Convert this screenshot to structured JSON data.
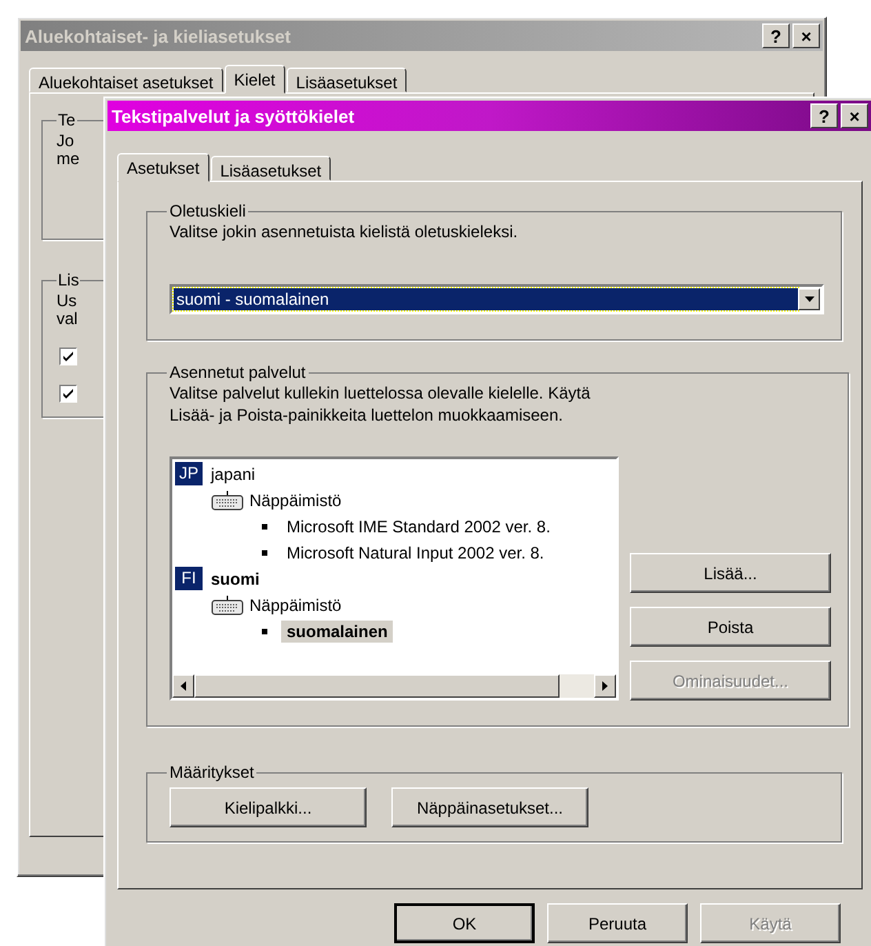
{
  "back_window": {
    "title": "Aluekohtaiset- ja kieliasetukset",
    "active": false,
    "title_buttons": [
      "?",
      "×"
    ],
    "tabs": [
      {
        "label": "Aluekohtaiset asetukset",
        "selected": false
      },
      {
        "label": "Kielet",
        "selected": true
      },
      {
        "label": "Lisäasetukset",
        "selected": false
      }
    ],
    "groups": [
      {
        "label": "Te",
        "lines": [
          "Jo",
          "me"
        ]
      },
      {
        "label": "Lis",
        "lines": [
          "Us",
          "val"
        ],
        "checkboxes": [
          {
            "checked": true
          },
          {
            "checked": true
          }
        ]
      }
    ]
  },
  "front_window": {
    "title": "Tekstipalvelut ja syöttökielet",
    "active": true,
    "title_buttons": [
      "?",
      "×"
    ],
    "tabs": [
      {
        "label": "Asetukset",
        "selected": true
      },
      {
        "label": "Lisäasetukset",
        "selected": false
      }
    ],
    "default_language": {
      "label": "Oletuskieli",
      "description": "Valitse jokin asennetuista kielistä oletuskieleksi.",
      "dropdown": {
        "value": "suomi - suomalainen"
      }
    },
    "installed_services": {
      "label": "Asennetut palvelut",
      "description_lines": [
        "Valitse palvelut kullekin luettelossa olevalle kielelle. Käytä",
        "Lisää- ja Poista-painikkeita luettelon muokkaamiseen."
      ],
      "tree": [
        {
          "kind": "language",
          "badge": "JP",
          "label": "japani",
          "default": false,
          "children": [
            {
              "kind": "keyboard",
              "label": "Näppäimistö",
              "children": [
                {
                  "kind": "service",
                  "label": "Microsoft IME Standard 2002 ver. 8.",
                  "selected": false
                },
                {
                  "kind": "service",
                  "label": "Microsoft Natural Input 2002 ver. 8.",
                  "selected": false
                }
              ]
            }
          ]
        },
        {
          "kind": "language",
          "badge": "FI",
          "label": "suomi",
          "default": true,
          "children": [
            {
              "kind": "keyboard",
              "label": "Näppäimistö",
              "children": [
                {
                  "kind": "service",
                  "label": "suomalainen",
                  "selected": true
                }
              ]
            }
          ]
        }
      ],
      "buttons": [
        {
          "label": "Lisää...",
          "disabled": false
        },
        {
          "label": "Poista",
          "disabled": false
        },
        {
          "label": "Ominaisuudet...",
          "disabled": true
        }
      ]
    },
    "preferences": {
      "label": "Määritykset",
      "buttons": [
        {
          "label": "Kielipalkki...",
          "disabled": false
        },
        {
          "label": "Näppäinasetukset...",
          "disabled": false
        }
      ]
    },
    "buttons": [
      {
        "label": "OK",
        "default": true,
        "disabled": false
      },
      {
        "label": "Peruuta",
        "default": false,
        "disabled": false
      },
      {
        "label": "Käytä",
        "default": false,
        "disabled": true
      }
    ]
  }
}
